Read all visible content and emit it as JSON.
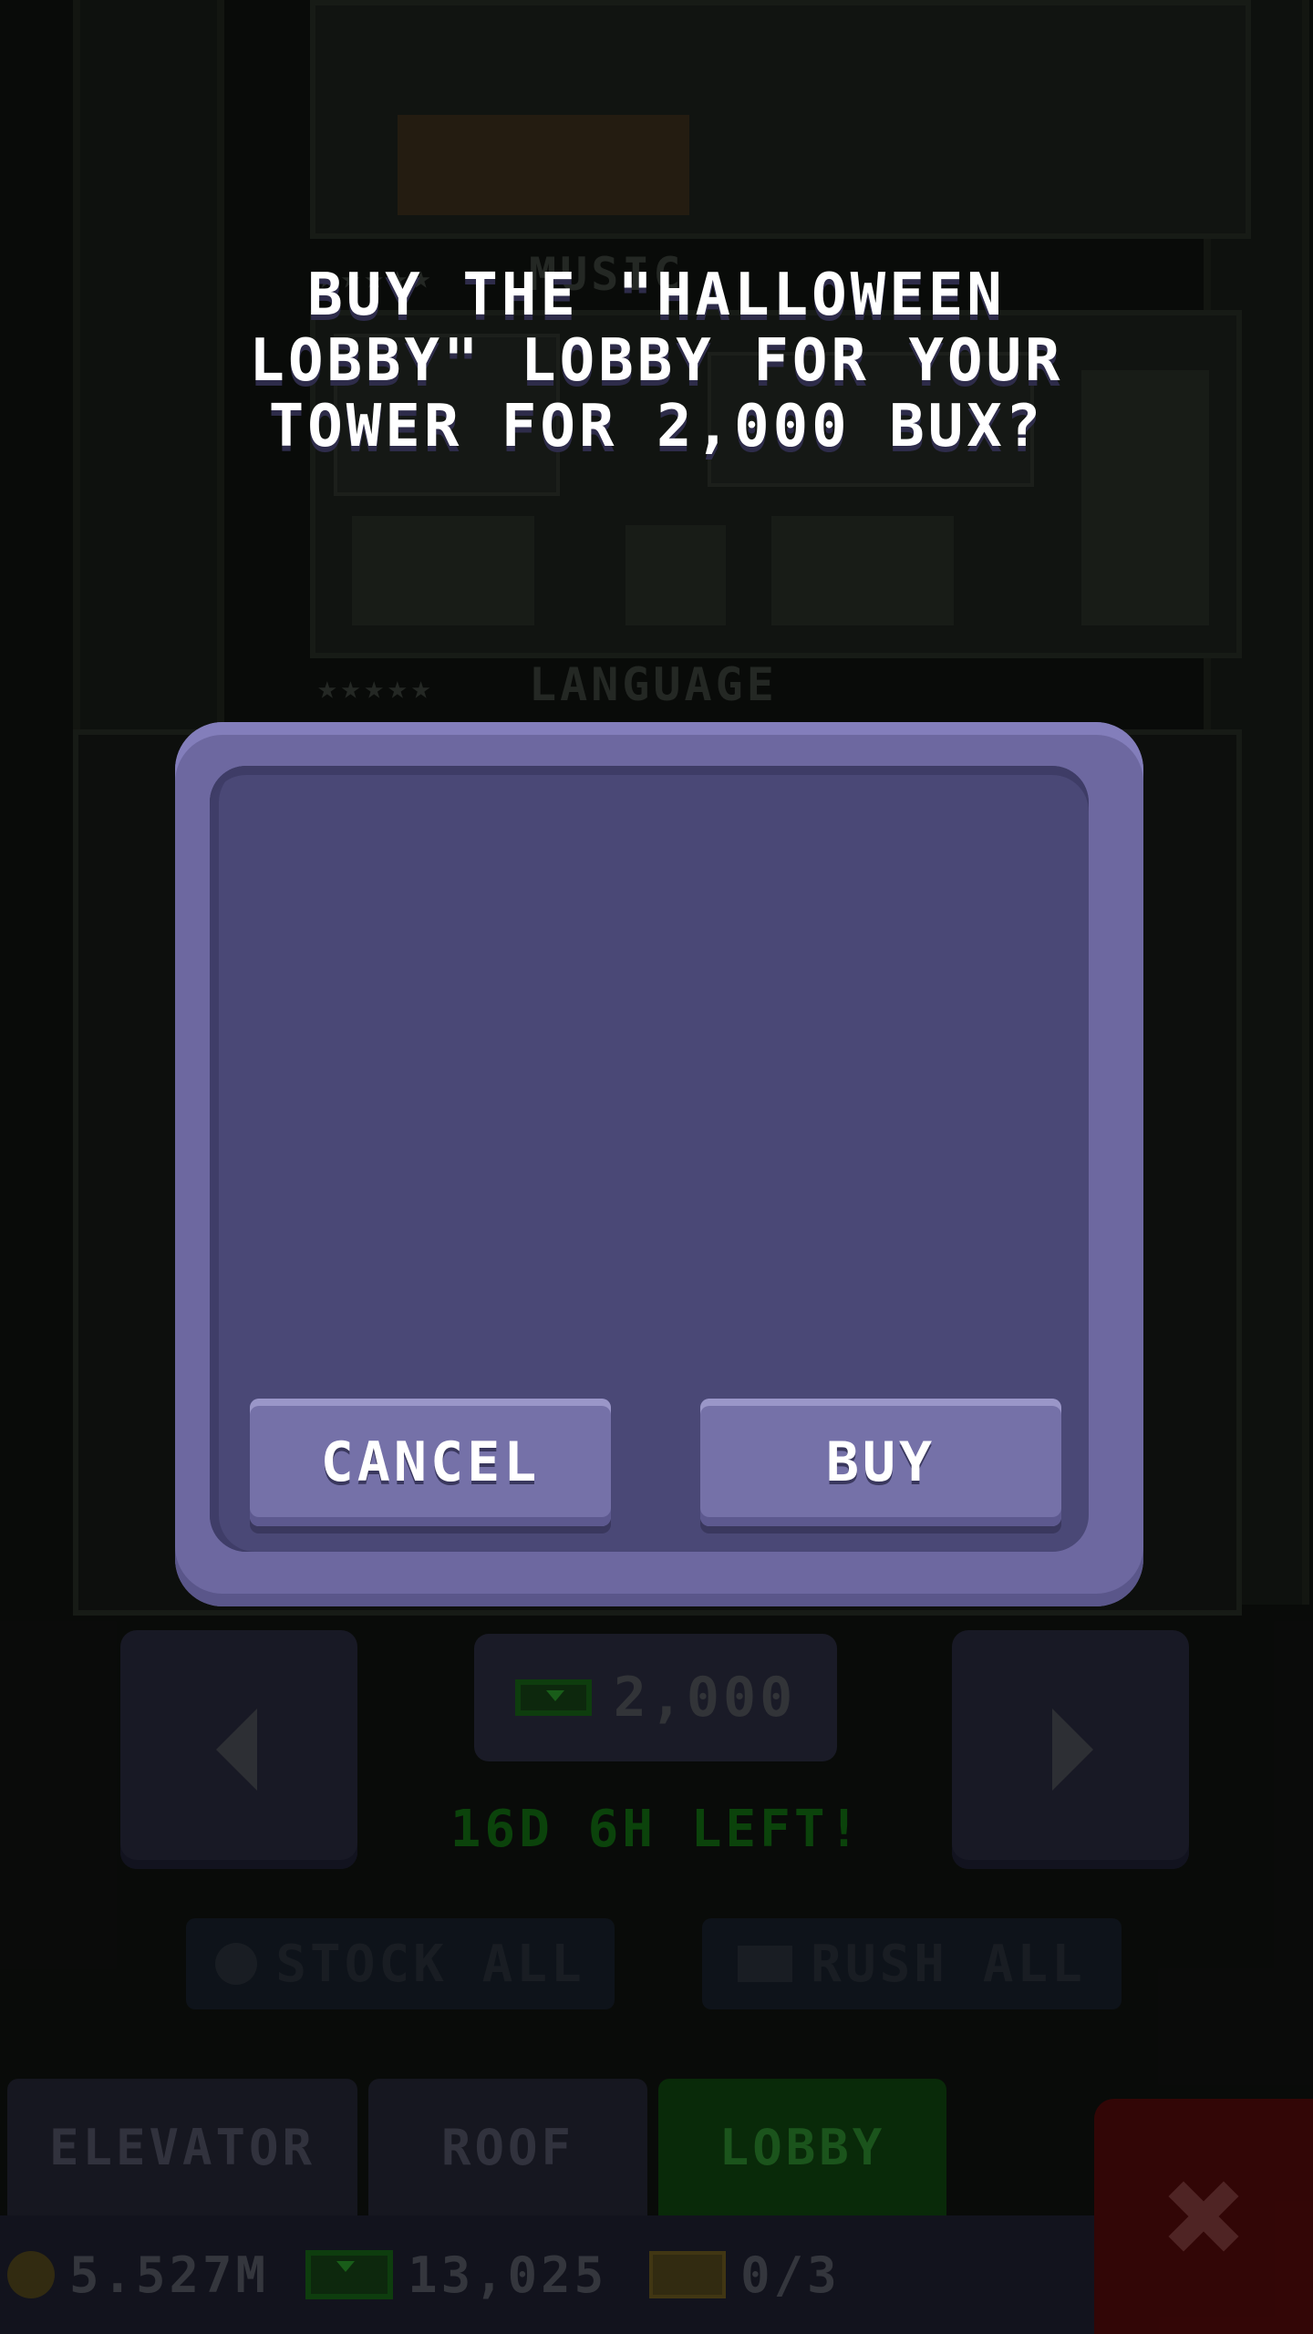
{
  "background": {
    "rooms": [
      {
        "stars": "★★★★★",
        "title": "Music"
      },
      {
        "stars": "★★★★★",
        "title": "Language"
      }
    ],
    "price": "2,000",
    "time_left": "16D 6H LEFT!",
    "stock_all_label": "STOCK ALL",
    "rush_all_label": "RUSH ALL"
  },
  "tabs": [
    {
      "label": "ELEVATOR",
      "active": false
    },
    {
      "label": "ROOF",
      "active": false
    },
    {
      "label": "LOBBY",
      "active": true
    }
  ],
  "status": {
    "coins": "5.527M",
    "bux": "13,025",
    "chests": "0/3"
  },
  "modal": {
    "message": "BUY THE \"HALLOWEEN LOBBY\" LOBBY FOR YOUR TOWER FOR 2,000 BUX?",
    "cancel_label": "CANCEL",
    "buy_label": "BUY"
  },
  "colors": {
    "modal_frame": "#6d68a0",
    "modal_panel": "#4a4876",
    "button": "#7571a8",
    "active_tab": "#0b300b",
    "close": "#3a0707"
  }
}
